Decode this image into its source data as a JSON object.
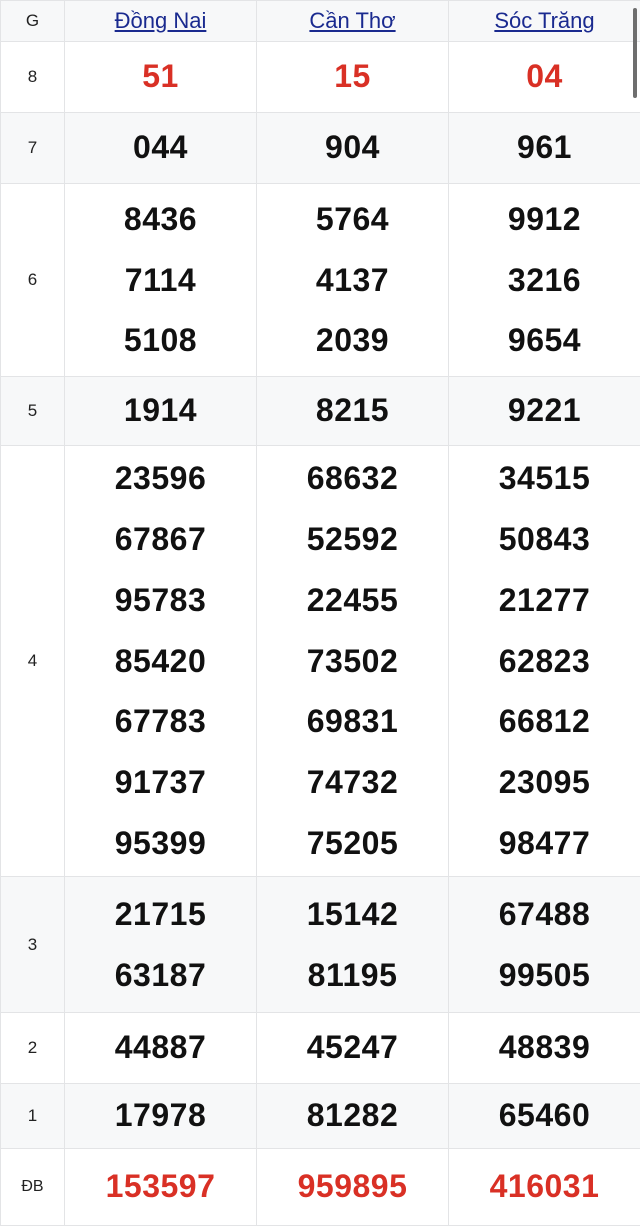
{
  "table": {
    "header": {
      "prize_column_label": "G",
      "provinces": [
        {
          "name": "Đồng Nai",
          "icon": "link-underline"
        },
        {
          "name": "Cần Thơ",
          "icon": "link-underline"
        },
        {
          "name": "Sóc Trăng",
          "icon": "link-underline"
        }
      ]
    },
    "rows": [
      {
        "prize": "8",
        "highlight": "red",
        "shaded": false,
        "cells": [
          [
            "51"
          ],
          [
            "15"
          ],
          [
            "04"
          ]
        ]
      },
      {
        "prize": "7",
        "highlight": "black",
        "shaded": true,
        "cells": [
          [
            "044"
          ],
          [
            "904"
          ],
          [
            "961"
          ]
        ]
      },
      {
        "prize": "6",
        "highlight": "black",
        "shaded": false,
        "cells": [
          [
            "8436",
            "7114",
            "5108"
          ],
          [
            "5764",
            "4137",
            "2039"
          ],
          [
            "9912",
            "3216",
            "9654"
          ]
        ]
      },
      {
        "prize": "5",
        "highlight": "black",
        "shaded": true,
        "cells": [
          [
            "1914"
          ],
          [
            "8215"
          ],
          [
            "9221"
          ]
        ]
      },
      {
        "prize": "4",
        "highlight": "black",
        "shaded": false,
        "cells": [
          [
            "23596",
            "67867",
            "95783",
            "85420",
            "67783",
            "91737",
            "95399"
          ],
          [
            "68632",
            "52592",
            "22455",
            "73502",
            "69831",
            "74732",
            "75205"
          ],
          [
            "34515",
            "50843",
            "21277",
            "62823",
            "66812",
            "23095",
            "98477"
          ]
        ]
      },
      {
        "prize": "3",
        "highlight": "black",
        "shaded": true,
        "cells": [
          [
            "21715",
            "63187"
          ],
          [
            "15142",
            "81195"
          ],
          [
            "67488",
            "99505"
          ]
        ]
      },
      {
        "prize": "2",
        "highlight": "black",
        "shaded": false,
        "cells": [
          [
            "44887"
          ],
          [
            "45247"
          ],
          [
            "48839"
          ]
        ]
      },
      {
        "prize": "1",
        "highlight": "black",
        "shaded": true,
        "cells": [
          [
            "17978"
          ],
          [
            "81282"
          ],
          [
            "65460"
          ]
        ]
      },
      {
        "prize": "ĐB",
        "highlight": "red",
        "shaded": false,
        "cells": [
          [
            "153597"
          ],
          [
            "959895"
          ],
          [
            "416031"
          ]
        ]
      }
    ]
  },
  "colors": {
    "link": "#1a2a8f",
    "special": "#d93025",
    "text": "#111111",
    "shade": "#f7f8f9",
    "border": "#e3e4e6",
    "scrollbar": "#6e6e6e"
  },
  "scrollbar": {
    "name": "vertical-scrollbar"
  }
}
